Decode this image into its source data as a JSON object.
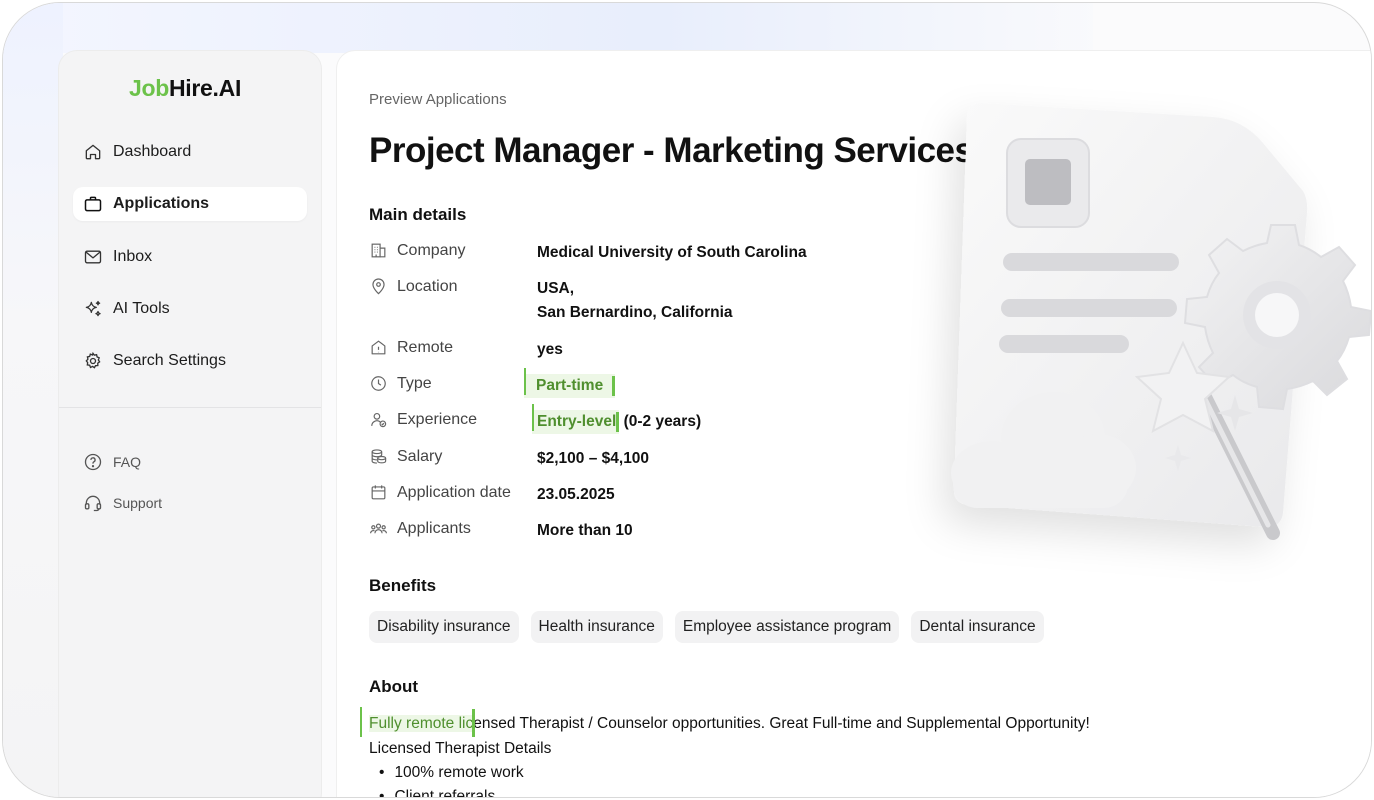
{
  "app": {
    "logo_part1": "Job",
    "logo_part2": "Hire.AI"
  },
  "sidebar": {
    "items": [
      {
        "label": "Dashboard",
        "icon": "home-icon"
      },
      {
        "label": "Applications",
        "icon": "briefcase-icon",
        "active": true
      },
      {
        "label": "Inbox",
        "icon": "mail-icon"
      },
      {
        "label": "AI Tools",
        "icon": "sparkles-icon"
      },
      {
        "label": "Search Settings",
        "icon": "gear-icon"
      }
    ],
    "secondary": [
      {
        "label": "FAQ",
        "icon": "help-circle-icon"
      },
      {
        "label": "Support",
        "icon": "headset-icon"
      }
    ]
  },
  "main": {
    "breadcrumb": "Preview Applications",
    "title": "Project Manager - Marketing Services",
    "main_details_heading": "Main details",
    "details": {
      "company": {
        "label": "Company",
        "value": "Medical University of South Carolina"
      },
      "location": {
        "label": "Location",
        "value_line1": "USA,",
        "value_line2": "San Bernardino, California"
      },
      "remote": {
        "label": "Remote",
        "value": "yes"
      },
      "type": {
        "label": "Type",
        "value": "Part-time"
      },
      "experience": {
        "label": "Experience",
        "value_hl": "Entry-level",
        "value_rest": " (0-2 years)"
      },
      "salary": {
        "label": "Salary",
        "value": "$2,100 – $4,100"
      },
      "application_date": {
        "label": "Application date",
        "value": "23.05.2025"
      },
      "applicants": {
        "label": "Applicants",
        "value": "More than 10"
      }
    },
    "benefits_heading": "Benefits",
    "benefits": [
      "Disability insurance",
      "Health insurance",
      "Employee assistance program",
      "Dental insurance"
    ],
    "about_heading": "About",
    "about": {
      "line1_hl": "Fully remote lic",
      "line1_rest": "ensed Therapist / Counselor opportunities. Great Full-time and Supplemental Opportunity!",
      "line2": "Licensed Therapist Details",
      "bullets": [
        "100% remote work",
        "Client referrals"
      ]
    }
  },
  "colors": {
    "brand_green": "#6cc24a",
    "highlight_bg": "#edf7e6",
    "highlight_text": "#4f8f2e"
  }
}
